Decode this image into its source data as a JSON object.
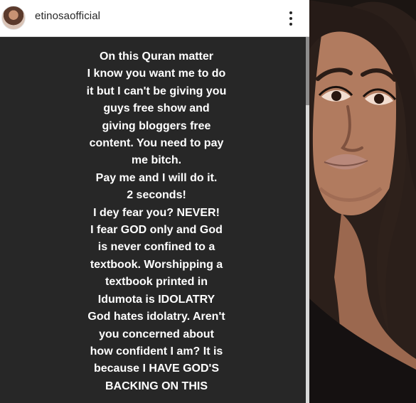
{
  "post": {
    "username": "etinosaofficial",
    "avatar_icon": "profile-photo",
    "more_icon": "more-options-icon",
    "text_lines": [
      "On this Quran matter",
      "I know you want me to do",
      "it but I can't be giving you",
      "guys free show and",
      "giving bloggers free",
      "content. You need to pay",
      "me bitch.",
      "Pay me and I will do it.",
      "2 seconds!",
      "I dey fear you? NEVER!",
      "I fear GOD only and God",
      "is never confined to a",
      "textbook. Worshipping a",
      "textbook printed in",
      "Idumota is IDOLATRY",
      "God hates idolatry. Aren't",
      "you concerned about",
      "how confident I am? It is",
      "because I HAVE GOD'S",
      "BACKING ON THIS"
    ]
  },
  "colors": {
    "post_background": "#272727",
    "header_background": "#ffffff",
    "text": "#ffffff",
    "username": "#262626"
  }
}
